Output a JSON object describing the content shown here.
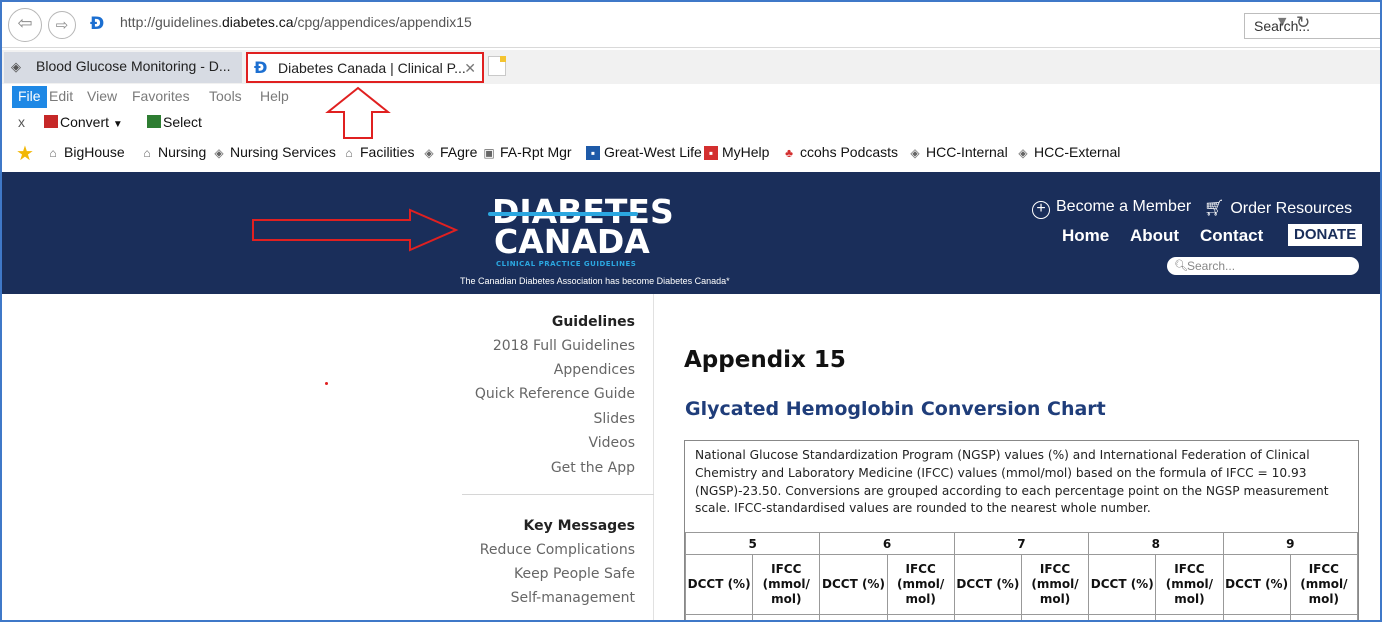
{
  "browser": {
    "url_prefix": "http://guidelines.",
    "url_domain": "diabetes.ca",
    "url_path": "/cpg/appendices/appendix15",
    "search_placeholder": "Search...",
    "tabs": [
      {
        "label": "Blood Glucose Monitoring - D...",
        "active": false
      },
      {
        "label": "Diabetes Canada | Clinical P...",
        "active": true
      }
    ],
    "menu": [
      "File",
      "Edit",
      "View",
      "Favorites",
      "Tools",
      "Help"
    ],
    "toolbar": {
      "close": "x",
      "convert": "Convert",
      "select": "Select"
    },
    "favorites": [
      "BigHouse",
      "Nursing",
      "Nursing Services",
      "Facilities",
      "FAgre",
      "FA-Rpt Mgr",
      "Great-West Life",
      "MyHelp",
      "ccohs Podcasts",
      "HCC-Internal",
      "HCC-External"
    ]
  },
  "site": {
    "logo_line1": "DIABETES",
    "logo_line2": "CANADA",
    "logo_line3": "CLINICAL PRACTICE GUIDELINES",
    "tagline": "The Canadian Diabetes Association has become Diabetes Canada*",
    "become_member": "Become a Member",
    "order_resources": "Order Resources",
    "nav": {
      "home": "Home",
      "about": "About",
      "contact": "Contact",
      "donate": "DONATE"
    },
    "search_placeholder": "Search...",
    "brand_color": "#1a2e5a",
    "accent_color": "#2ba7e0"
  },
  "sidebar": {
    "guidelines_heading": "Guidelines",
    "guidelines_items": [
      "2018 Full Guidelines",
      "Appendices",
      "Quick Reference Guide",
      "Slides",
      "Videos",
      "Get the App"
    ],
    "key_heading": "Key Messages",
    "key_items": [
      "Reduce Complications",
      "Keep People Safe",
      "Self-management"
    ]
  },
  "main": {
    "title": "Appendix 15",
    "subtitle": "Glycated Hemoglobin Conversion Chart",
    "intro": "National Glucose Standardization Program (NGSP) values (%) and International Federation of Clinical Chemistry and Laboratory Medicine (IFCC) values (mmol/mol) based on the formula of IFCC = 10.93 (NGSP)-23.50. Conversions are grouped according to each percentage point on the NGSP measurement scale. IFCC-standardised values are rounded to the nearest whole number.",
    "groups": [
      "5",
      "6",
      "7",
      "8",
      "9"
    ],
    "col_dcct": "DCCT (%)",
    "col_ifcc": "IFCC (mmol/ mol)"
  }
}
